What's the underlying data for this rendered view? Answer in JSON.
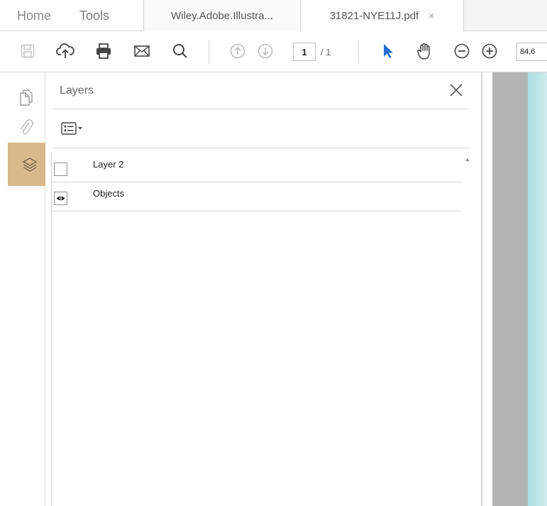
{
  "tabs": {
    "home": "Home",
    "tools": "Tools",
    "doc1": "Wiley.Adobe.Illustra...",
    "doc2": "31821-NYE11J.pdf",
    "close_glyph": "×"
  },
  "toolbar": {
    "icons": [
      "save-icon",
      "upload-icon",
      "print-icon",
      "email-icon",
      "search-icon",
      "prev-page-icon",
      "next-page-icon",
      "select-pointer-icon",
      "hand-icon",
      "zoom-out-icon",
      "zoom-in-icon"
    ],
    "page_current": "1",
    "page_total": "/ 1",
    "zoom": "84,6"
  },
  "rail": {
    "icons": [
      "pages-icon",
      "attachment-icon",
      "layers-icon"
    ],
    "active": "layers-icon",
    "active_color": "#d8b98c"
  },
  "layers_panel": {
    "title": "Layers",
    "layers": [
      {
        "name": "Layer 2",
        "visible": false
      },
      {
        "name": "Objects",
        "visible": true
      }
    ]
  },
  "colors": {
    "accent_blue": "#1d6fd6",
    "page_tint": "#a9dde3"
  }
}
